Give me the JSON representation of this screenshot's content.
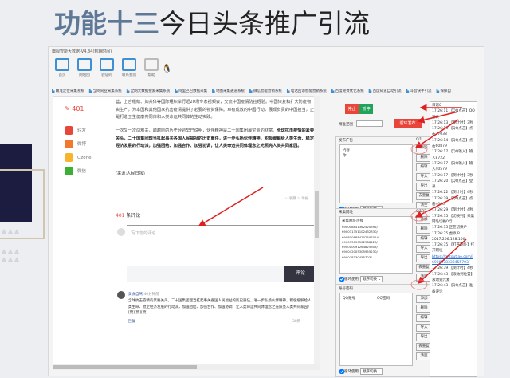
{
  "slide": {
    "title_bold": "功能十三",
    "title_rest": "今日头条推广引流"
  },
  "window": {
    "title": "旗舰智能大数据-V4.84(到期时间)",
    "toolbar": [
      "首页",
      "网站图",
      "验证码",
      "联系我们",
      "帮助"
    ],
    "tabs": [
      "精准定位采集系统",
      "全网同业采集系统",
      "全网大数据搜索采集系统",
      "阿里巴巴数据采集",
      "地图采集通道系统",
      "微信智能营销系统",
      "电话回访智能营销系统",
      "百度免费优化系统",
      "百度知道自动引流",
      "斗音快手引流",
      "探探自"
    ]
  },
  "article": {
    "like_count": "401",
    "share": [
      "转发",
      "微博",
      "Qzone",
      "微信"
    ],
    "p1": "篮，上合组织、如共体等国际组织举行近20场专家视频会，交流中国疫情防控经验。中国恢复和扩大防疫物资生产，为本国和其他国家抗击疫情提供了必要的物资保障。卓有成效的中国行动，展现负责的中国担当，正是打造卫生健康共同体和人类命运共同体的生动实践。",
    "p2": "一次又一次闯难关，跨越险的历史经验早已说明，伙伴精神是二十国集团最宝贵的财富。",
    "p2_bold": "全球抗击疫情的紧要关头，二十国集团理当扛起事关各国人民福祉的历史重任，进一步弘扬伙伴精神，积极缓解给人类生命、稳定经济发展的行动派，加强团结、加强合作、加强协调，让人类命运共同体理念之光照亮人类共同家园。",
    "source": "(来源:人民日报)",
    "actions": "☆ 收藏  ⚐ 举报",
    "comment_count": "401",
    "comment_label": "条评论",
    "comment_placeholder": "写下您的评论...",
    "comment_button": "评论",
    "comment": {
      "user": "美食自驾",
      "time": "40分钟前",
      "text": "全球抗击疫情的紧要关头，二十国集团理当扛起事关各国人民福祉的历史重任，进一步弘扬伙伴精神，积极缓解给人类生命、稳定经济发展的行动派，加强团结、加强合作、加强协调，让人类命运共同体理念之光照亮人类共同家园！[赞][赞][赞]",
      "reply": "回复",
      "likes": "38赞"
    }
  },
  "controls": {
    "stop": "停止",
    "pause": "暂停",
    "range_label": "精准范围",
    "range_value": "",
    "loop_publish": "循环发布",
    "buttons": [
      "添加",
      "删除",
      "编辑",
      "导入",
      "导出",
      "去重复",
      "清空"
    ],
    "loop_use": "循环使用",
    "order": "顺序切换 ⌄",
    "ads": {
      "title": "发布广告",
      "count": "0/1",
      "items": [
        "内容",
        "你"
      ]
    },
    "urls": {
      "title": "采集网址",
      "count": "0/132",
      "header": "采集网址连接",
      "items": [
        "690008841362520392/",
        "690031351102432330/",
        "6908008884202507024/",
        "690033050502368423/",
        "690010091264825305/",
        "690042005305955230/",
        "690078330455703/"
      ]
    },
    "accounts": {
      "title": "账号密码",
      "col1": "QQ账号",
      "col2": "QQ密码"
    }
  },
  "log": [
    "日志0",
    "17:26:11 【QQ点击】QQ登录",
    "17:26:13 【倒计时】3秒",
    "17:26:15 【QQ点击】点击77038",
    "17:26:14 【QQ点击】点击60879",
    "17:26:17 【QQ输入】输入8722",
    "17:26:17 【QQ输入】输入40579",
    "17:26:17 【倒计时】3秒",
    "17:26:20 【QQ点击】登录",
    "17:26:22 【倒计时】4秒",
    "17:26:29 【QQ点击】点击4000",
    "17:26:29 【倒计时】4秒",
    "17:26:35 【切换列】采集网址切换0行",
    "17:26:35 正在切换IP",
    "17:26:35 虚拟IP 2017.206.128.100",
    "17:26:35 【打开网址】打开网址",
    "https://m.toutiao.com/i6900078330455703/",
    "17:26:39 【倒计时】4秒",
    "17:26:43 【滚动到位置】滚动到元素",
    "17:26:43 【QQ点击】准备评论"
  ],
  "colors": {
    "accent": "#e8463a",
    "green": "#22a35a",
    "title": "#5f7896",
    "navy": "#1c1b40"
  }
}
